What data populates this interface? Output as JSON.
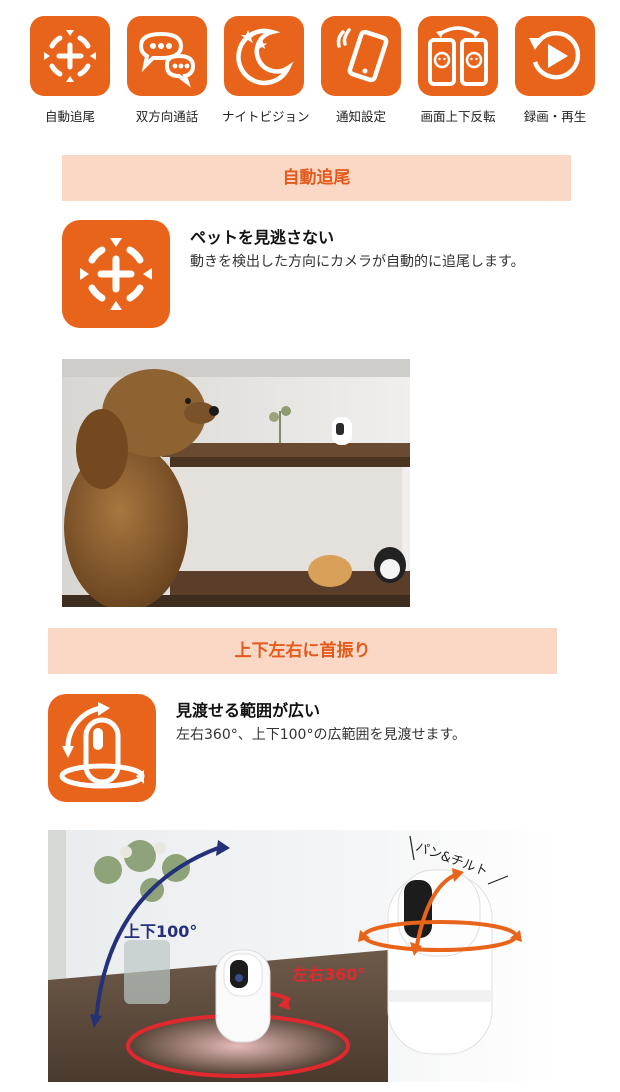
{
  "features": [
    {
      "label": "自動追尾",
      "icon": "auto-tracking-icon"
    },
    {
      "label": "双方向通話",
      "icon": "two-way-talk-icon"
    },
    {
      "label": "ナイトビジョン",
      "icon": "night-vision-icon"
    },
    {
      "label": "通知設定",
      "icon": "notification-icon"
    },
    {
      "label": "画面上下反転",
      "icon": "screen-flip-icon"
    },
    {
      "label": "録画・再生",
      "icon": "record-play-icon"
    }
  ],
  "section1": {
    "heading": "自動追尾",
    "title": "ペットを見逃さない",
    "desc": "動きを検出した方向にカメラが自動的に追尾します。",
    "icon": "auto-tracking-icon",
    "photo": "dog-and-camera-photo"
  },
  "section2": {
    "heading": "上下左右に首振り",
    "title": "見渡せる範囲が広い",
    "desc": "左右360°、上下100°の広範囲を見渡せます。",
    "icon": "pan-tilt-icon",
    "photo": {
      "vertical_label": "上下100°",
      "horizontal_label": "左右360°",
      "pan_tilt_label": "パン&チルト"
    }
  },
  "colors": {
    "accent": "#e8641b",
    "band": "#fbd8c5",
    "heading_text": "#e35a1c",
    "tilt_arrow": "#24307a",
    "pan_arrow": "#e0292e"
  }
}
